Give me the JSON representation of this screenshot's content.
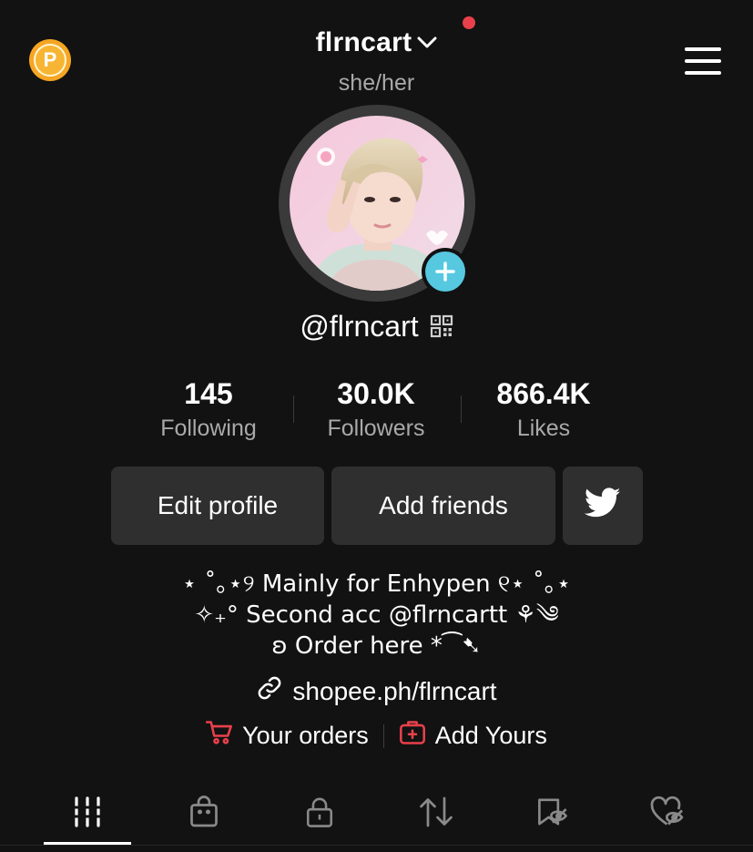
{
  "header": {
    "username": "flrncart",
    "pronouns": "she/her",
    "coin_icon": "coin-icon",
    "notification_dot_color": "#e8404b"
  },
  "profile": {
    "handle": "@flrncart",
    "stats": [
      {
        "value": "145",
        "label": "Following"
      },
      {
        "value": "30.0K",
        "label": "Followers"
      },
      {
        "value": "866.4K",
        "label": "Likes"
      }
    ]
  },
  "actions": {
    "edit_profile": "Edit profile",
    "add_friends": "Add friends",
    "twitter_icon": "twitter-icon"
  },
  "bio": {
    "lines": [
      "⋆ ˚｡⋆୨ Mainly for Enhypen ୧⋆ ˚｡⋆",
      "✧₊° Second acc @flrncartt ⚘༄",
      "ʚ Order here *⁀➷"
    ],
    "link": "shopee.ph/flrncart"
  },
  "extras": {
    "orders": "Your orders",
    "add_yours": "Add Yours"
  },
  "tabs": [
    {
      "icon": "grid-icon",
      "active": true
    },
    {
      "icon": "shopping-bag-icon",
      "active": false
    },
    {
      "icon": "lock-icon",
      "active": false
    },
    {
      "icon": "repost-icon",
      "active": false
    },
    {
      "icon": "hidden-bookmark-icon",
      "active": false
    },
    {
      "icon": "hidden-heart-icon",
      "active": false
    }
  ],
  "colors": {
    "background": "#121212",
    "button_bg": "#2f2f2f",
    "secondary_text": "#a9a9a9",
    "accent_red": "#e8404b",
    "add_avatar": "#56c8e0",
    "coin": "#f6a623"
  }
}
